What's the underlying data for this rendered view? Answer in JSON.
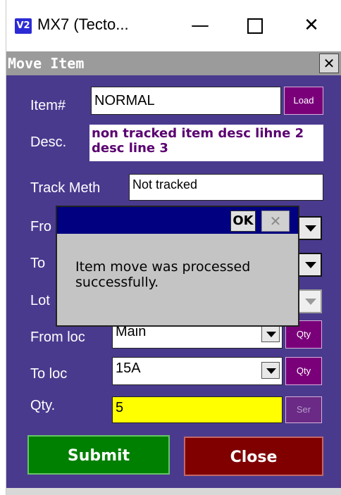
{
  "window": {
    "app_icon": "V2",
    "title": "MX7 (Tecto...",
    "minimize_glyph": "—",
    "close_glyph": "✕"
  },
  "app": {
    "header_title": "Move Item",
    "header_close": "✕"
  },
  "form": {
    "item_label": "Item#",
    "item_value": "NORMAL",
    "load_label": "Load",
    "desc_label": "Desc.",
    "desc_value": "non tracked item desc lihne 2 desc line 3",
    "track_label": "Track Meth",
    "track_value": "Not tracked",
    "from_label": "Fro",
    "to_label": "To",
    "lot_label": "Lot",
    "from_loc_label": "From loc",
    "from_loc_value": "Main",
    "to_loc_label": "To loc",
    "to_loc_value": "15A",
    "qty_btn_label": "Qty",
    "qty_label": "Qty.",
    "qty_value": "5",
    "ser_label": "Ser"
  },
  "buttons": {
    "submit": "Submit",
    "close": "Close"
  },
  "dialog": {
    "ok": "OK",
    "close": "✕",
    "message": "Item move was processed successfully."
  },
  "colors": {
    "pane_bg": "#4a3a8e",
    "header_bg": "#9b9b9b",
    "dialog_title_bg": "#000080",
    "submit_bg": "#008000",
    "close_bg": "#800000",
    "qty_field_bg": "#ffff00",
    "accent_btn": "#7a007a"
  },
  "icons": [
    "app-icon",
    "minimize-icon",
    "maximize-icon",
    "close-icon",
    "dropdown-arrow-icon"
  ]
}
